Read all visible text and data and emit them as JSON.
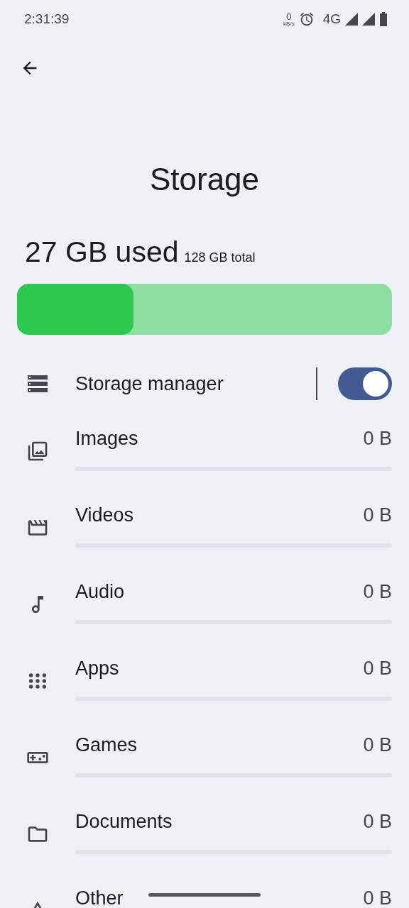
{
  "status_bar": {
    "time": "2:31:39",
    "net_speed": "0",
    "net_unit": "kB/s",
    "network": "4G"
  },
  "title": "Storage",
  "usage": {
    "used": "27 GB used",
    "total": "128 GB total",
    "level": 0.31
  },
  "storage_manager": {
    "label": "Storage manager",
    "on": true
  },
  "categories": [
    {
      "label": "Images",
      "size": "0 B",
      "level": 0
    },
    {
      "label": "Videos",
      "size": "0 B",
      "level": 0
    },
    {
      "label": "Audio",
      "size": "0 B",
      "level": 0
    },
    {
      "label": "Apps",
      "size": "0 B",
      "level": 0
    },
    {
      "label": "Games",
      "size": "0 B",
      "level": 0
    },
    {
      "label": "Documents",
      "size": "0 B",
      "level": 0
    },
    {
      "label": "Other",
      "size": "0 B"
    }
  ]
}
